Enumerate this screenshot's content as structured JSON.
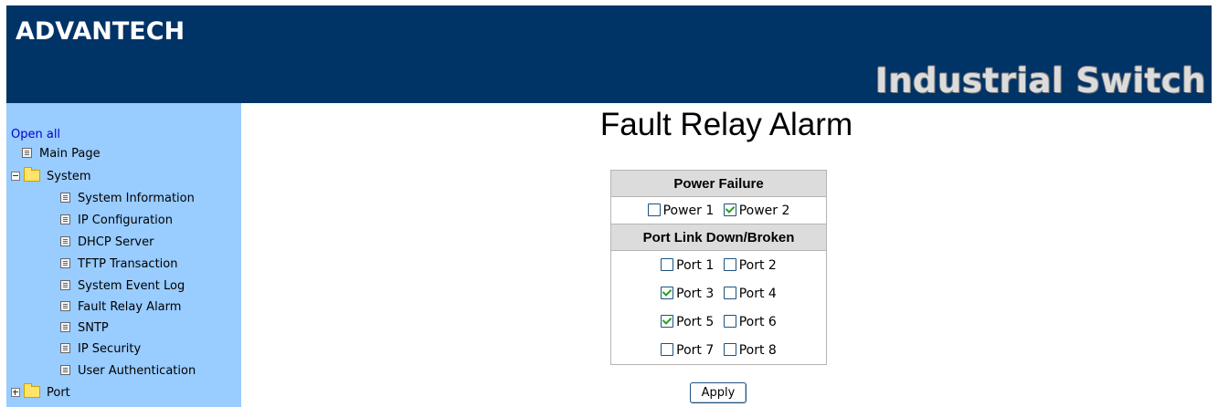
{
  "header": {
    "brand": "ADVANTECH",
    "product": "Industrial Switch",
    "bg_color": "#003366"
  },
  "sidebar": {
    "bg_color": "#99ccff",
    "open_all": "Open all",
    "items": [
      {
        "label": "Main Page",
        "icon": "page-icon"
      },
      {
        "label": "System",
        "icon": "folder-open-icon",
        "expanded": true
      },
      {
        "label": "System Information",
        "icon": "page-icon"
      },
      {
        "label": "IP Configuration",
        "icon": "page-icon"
      },
      {
        "label": "DHCP Server",
        "icon": "page-icon"
      },
      {
        "label": "TFTP Transaction",
        "icon": "page-icon"
      },
      {
        "label": "System Event Log",
        "icon": "page-icon"
      },
      {
        "label": "Fault Relay Alarm",
        "icon": "page-icon"
      },
      {
        "label": "SNTP",
        "icon": "page-icon"
      },
      {
        "label": "IP Security",
        "icon": "page-icon"
      },
      {
        "label": "User Authentication",
        "icon": "page-icon"
      },
      {
        "label": "Port",
        "icon": "folder-icon",
        "expanded": false
      }
    ]
  },
  "main": {
    "title": "Fault Relay Alarm",
    "power_section": {
      "header": "Power Failure",
      "options": [
        {
          "label": "Power 1",
          "checked": false
        },
        {
          "label": "Power 2",
          "checked": true
        }
      ]
    },
    "port_section": {
      "header": "Port Link Down/Broken",
      "ports": [
        {
          "label": "Port 1",
          "checked": false
        },
        {
          "label": "Port 2",
          "checked": false
        },
        {
          "label": "Port 3",
          "checked": true
        },
        {
          "label": "Port 4",
          "checked": false
        },
        {
          "label": "Port 5",
          "checked": true
        },
        {
          "label": "Port 6",
          "checked": false
        },
        {
          "label": "Port 7",
          "checked": false
        },
        {
          "label": "Port 8",
          "checked": false
        }
      ]
    },
    "apply_label": "Apply"
  }
}
